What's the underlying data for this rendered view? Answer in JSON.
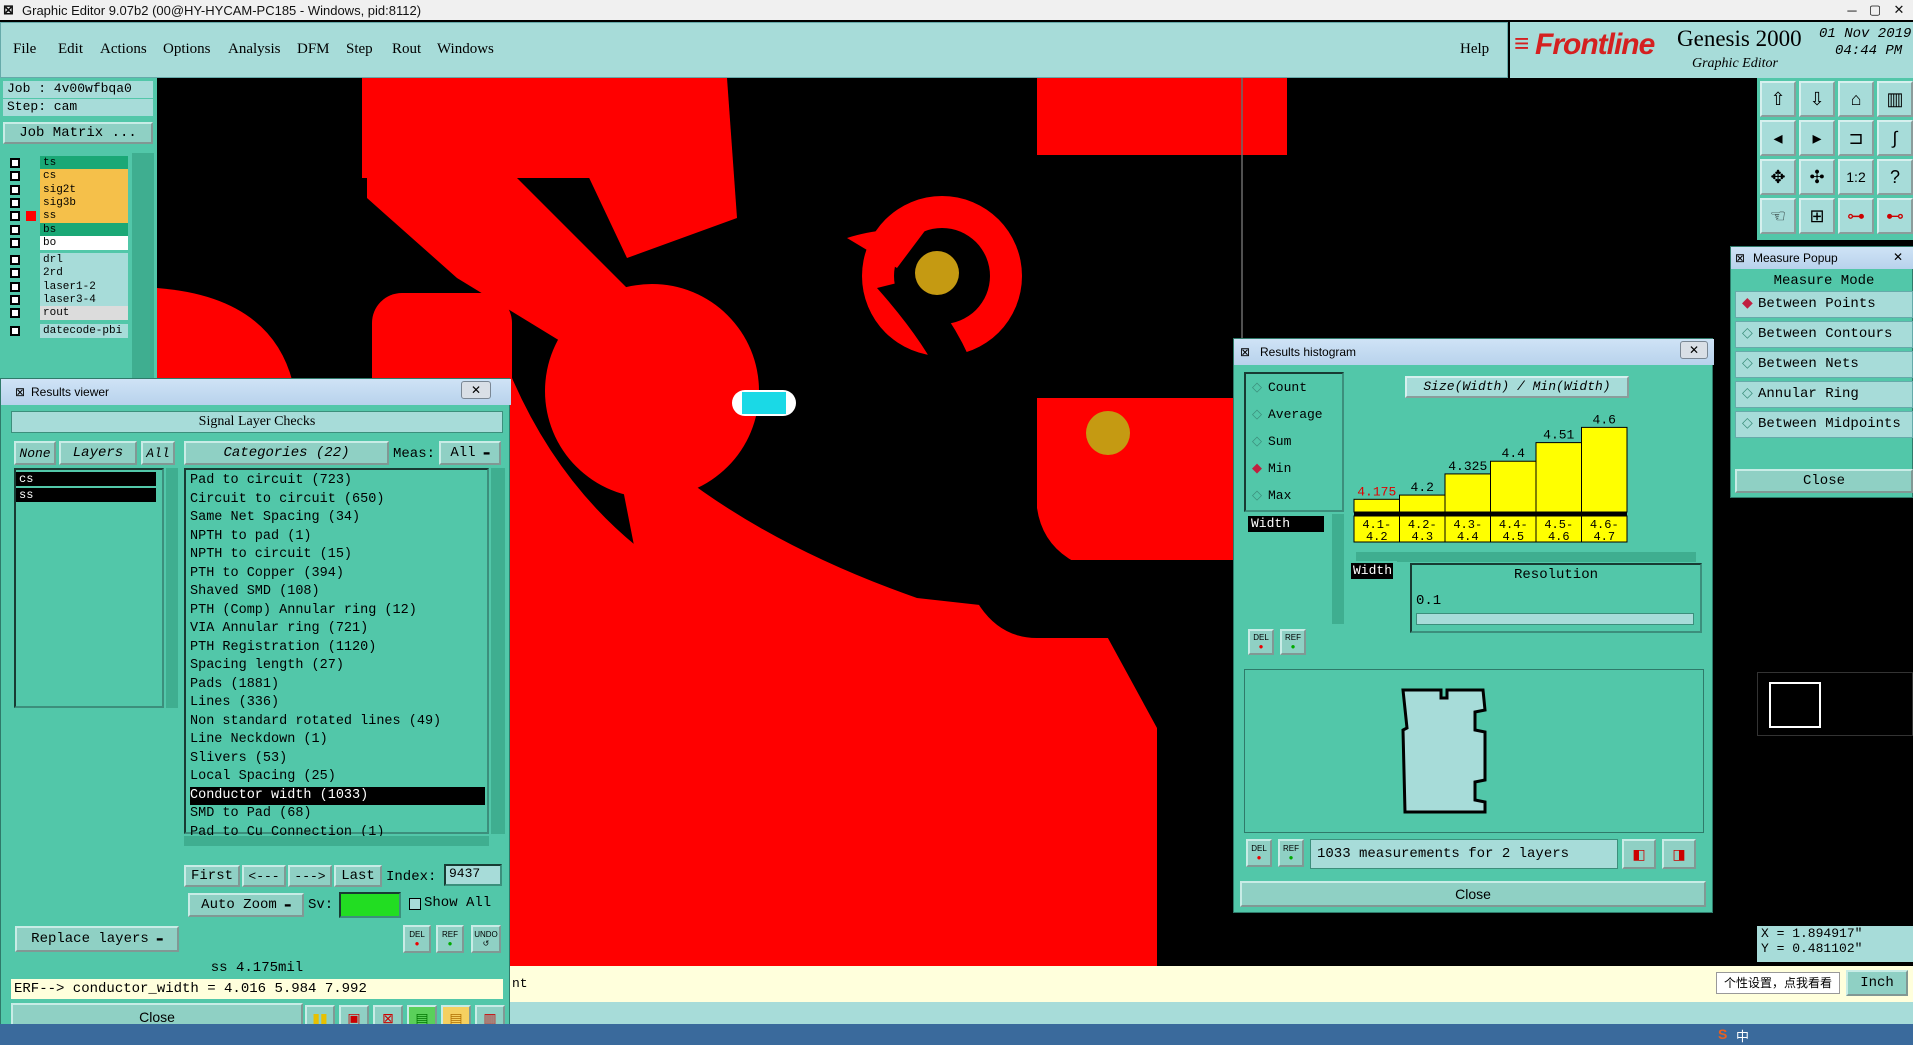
{
  "window": {
    "title": "Graphic Editor 9.07b2 (00@HY-HYCAM-PC185 - Windows, pid:8112)"
  },
  "menu": [
    "File",
    "Edit",
    "Actions",
    "Options",
    "Analysis",
    "DFM",
    "Step",
    "Rout",
    "Windows"
  ],
  "help_label": "Help",
  "brand": {
    "logo": "Frontline",
    "product": "Genesis 2000",
    "subtitle": "Graphic Editor",
    "date": "01 Nov 2019",
    "time": "04:44 PM"
  },
  "job": {
    "job_line": "Job : 4v00wfbqa0",
    "step_line": "Step: cam",
    "matrix_button": "Job Matrix ..."
  },
  "layers": [
    {
      "name": "ts",
      "color": "#1aa876"
    },
    {
      "name": "cs",
      "color": "#f5c04a"
    },
    {
      "name": "sig2t",
      "color": "#f5c04a"
    },
    {
      "name": "sig3b",
      "color": "#f5c04a"
    },
    {
      "name": "ss",
      "color": "#f5c04a"
    },
    {
      "name": "bs",
      "color": "#1aa876"
    },
    {
      "name": "bo",
      "color": "#ffffff"
    },
    {
      "name": "drl",
      "color": "#a7dcd9"
    },
    {
      "name": "2rd",
      "color": "#a7dcd9"
    },
    {
      "name": "laser1-2",
      "color": "#a7dcd9"
    },
    {
      "name": "laser3-4",
      "color": "#a7dcd9"
    },
    {
      "name": "rout",
      "color": "#dcdcdc"
    },
    {
      "name": "datecode-pbi",
      "color": "#a7dcd9"
    }
  ],
  "results_viewer": {
    "title": "Results viewer",
    "header": "Signal Layer Checks",
    "none_btn": "None",
    "layers_btn": "Layers",
    "all_btn": "All",
    "layer_list": [
      "cs",
      "ss"
    ],
    "categories_btn": "Categories (22)",
    "meas_label": "Meas:",
    "meas_value": "All",
    "categories": [
      "Pad to circuit (723)",
      "Circuit to circuit (650)",
      "Same Net Spacing (34)",
      "NPTH to pad (1)",
      "NPTH to circuit (15)",
      "PTH to Copper (394)",
      "Shaved SMD (108)",
      "PTH (Comp) Annular ring (12)",
      "VIA Annular ring (721)",
      "PTH Registration (1120)",
      "Spacing length (27)",
      "Pads (1881)",
      "Lines (336)",
      "Non standard rotated lines (49)",
      "Line Neckdown (1)",
      "Slivers (53)",
      "Local Spacing (25)",
      "Conductor width (1033)",
      "SMD to Pad (68)",
      "Pad to Cu Connection (1)"
    ],
    "selected_index": 17,
    "nav": {
      "first": "First",
      "prev": "<---",
      "next": "--->",
      "last": "Last",
      "index_label": "Index:",
      "index_value": "9437"
    },
    "auto_zoom": "Auto Zoom",
    "sv_label": "Sv:",
    "show_all": "Show All",
    "replace_layers": "Replace layers",
    "status": "ss 4.175mil",
    "erf_line": "ERF--> conductor_width = 4.016 5.984 7.992",
    "close": "Close",
    "del": "DEL",
    "ref": "REF",
    "undo": "UNDO"
  },
  "histogram": {
    "title": "Results histogram",
    "modes": [
      "Count",
      "Average",
      "Sum",
      "Min",
      "Max"
    ],
    "selected_mode": "Min",
    "attr": "Width",
    "chart_title": "Size(Width) / Min(Width)",
    "values": [
      "4.175",
      "4.2",
      "4.325",
      "4.4",
      "4.51",
      "4.6"
    ],
    "bins": [
      "4.1-\n4.2",
      "4.2-\n4.3",
      "4.3-\n4.4",
      "4.4-\n4.5",
      "4.5-\n4.6",
      "4.6-\n4.7"
    ],
    "resolution_label": "Resolution",
    "resolution_value": "0.1",
    "summary": "1033 measurements for 2 layers",
    "close": "Close"
  },
  "chart_data": {
    "type": "bar",
    "title": "Size(Width) / Min(Width)",
    "categories": [
      "4.1-4.2",
      "4.2-4.3",
      "4.3-4.4",
      "4.4-4.5",
      "4.5-4.6",
      "4.6-4.7"
    ],
    "values": [
      4.175,
      4.2,
      4.325,
      4.4,
      4.51,
      4.6
    ]
  },
  "measure": {
    "title": "Measure Popup",
    "header": "Measure Mode",
    "modes": [
      "Between Points",
      "Between Contours",
      "Between Nets",
      "Annular Ring",
      "Between Midpoints"
    ],
    "selected": "Between Points",
    "close": "Close"
  },
  "coords": {
    "x": "X = 1.894917\"",
    "y": "Y = 0.481102\""
  },
  "units": "Inch",
  "status_tail": "nt",
  "ime_tooltip": "个性设置，点我看看",
  "ime_label": "中"
}
